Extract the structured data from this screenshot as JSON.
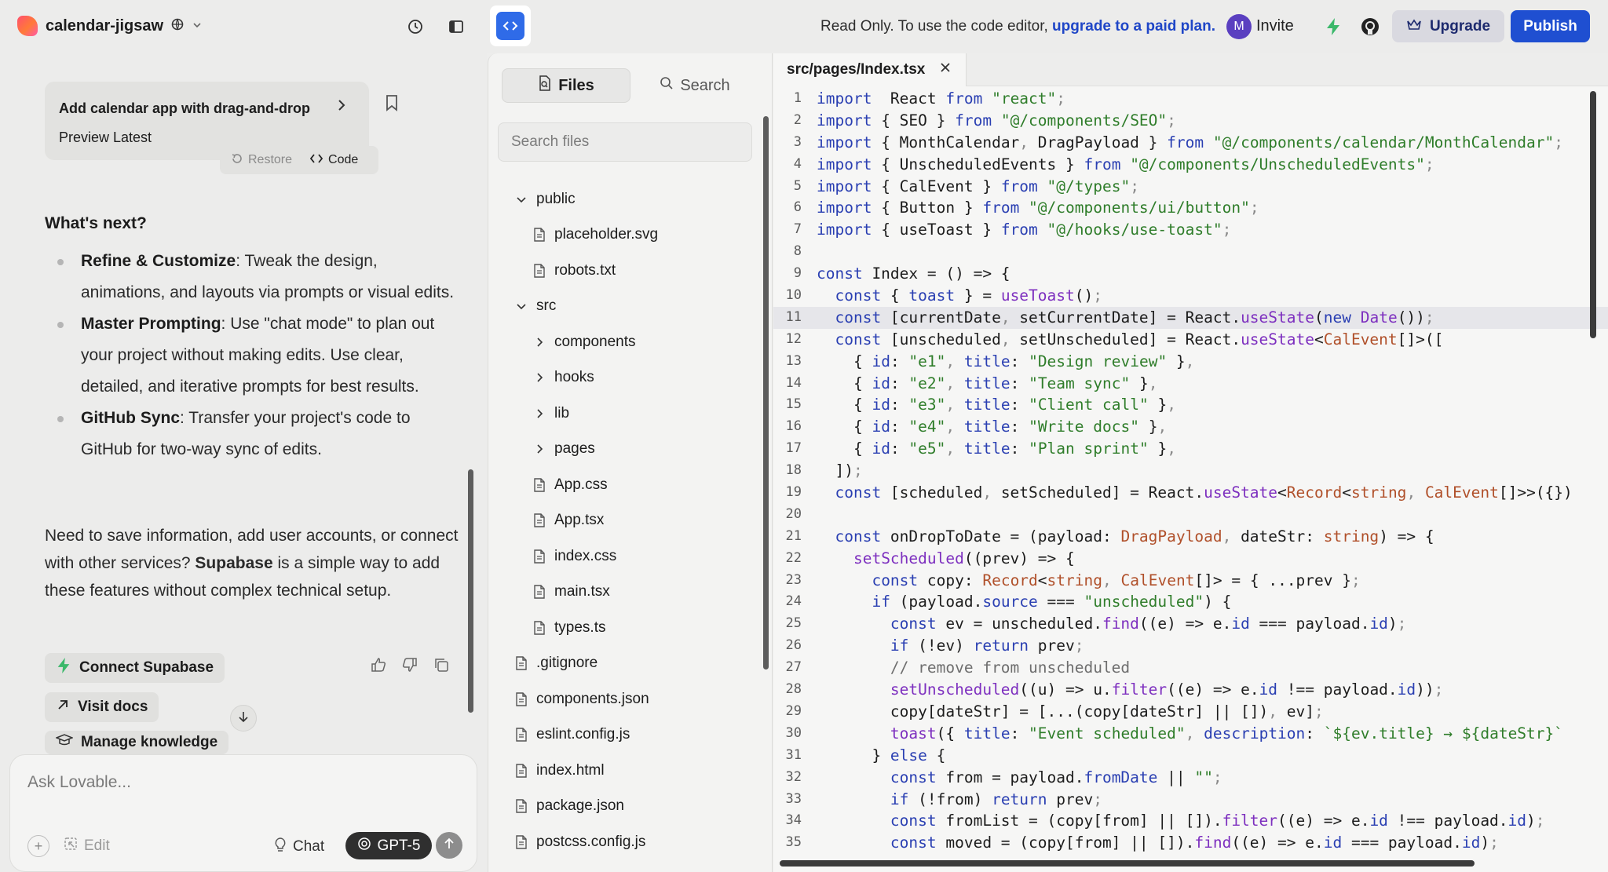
{
  "topbar": {
    "project_name": "calendar-jigsaw",
    "readonly_text": "Read Only. To use the code editor,",
    "upgrade_link": "upgrade to a paid plan.",
    "avatar_initial": "M",
    "invite_label": "Invite",
    "upgrade_label": "Upgrade",
    "publish_label": "Publish",
    "accent_color": "#2f6be8"
  },
  "chat": {
    "message_title": "Add calendar app with drag-and-drop",
    "message_sub": "Preview Latest",
    "restore_label": "Restore",
    "code_label": "Code",
    "whats_next": "What's next?",
    "bullets": [
      {
        "bold": "Refine & Customize",
        "text": ": Tweak the design, animations, and layouts via prompts or visual edits."
      },
      {
        "bold": "Master Prompting",
        "text": ": Use \"chat mode\" to plan out your project without making edits. Use clear, detailed, and iterative prompts for best results."
      },
      {
        "bold": "GitHub Sync",
        "text": ": Transfer your project's code to GitHub for two-way sync of edits."
      }
    ],
    "supabase_pre": "Need to save information, add user accounts, or connect with other services? ",
    "supabase_bold": "Supabase",
    "supabase_post": " is a simple way to add these features without complex technical setup.",
    "connect_supabase": "Connect Supabase",
    "visit_docs": "Visit docs",
    "manage_knowledge": "Manage knowledge",
    "composer_placeholder": "Ask Lovable...",
    "edit_label": "Edit",
    "chat_label": "Chat",
    "model_label": "GPT-5"
  },
  "explorer": {
    "files_tab": "Files",
    "search_tab": "Search",
    "search_placeholder": "Search files",
    "items": [
      {
        "name": "public",
        "type": "folder-open",
        "indent": 0
      },
      {
        "name": "placeholder.svg",
        "type": "file",
        "indent": 1
      },
      {
        "name": "robots.txt",
        "type": "file",
        "indent": 1
      },
      {
        "name": "src",
        "type": "folder-open",
        "indent": 0
      },
      {
        "name": "components",
        "type": "folder-closed",
        "indent": 1
      },
      {
        "name": "hooks",
        "type": "folder-closed",
        "indent": 1
      },
      {
        "name": "lib",
        "type": "folder-closed",
        "indent": 1
      },
      {
        "name": "pages",
        "type": "folder-closed",
        "indent": 1
      },
      {
        "name": "App.css",
        "type": "file",
        "indent": 1
      },
      {
        "name": "App.tsx",
        "type": "file",
        "indent": 1
      },
      {
        "name": "index.css",
        "type": "file",
        "indent": 1
      },
      {
        "name": "main.tsx",
        "type": "file",
        "indent": 1
      },
      {
        "name": "types.ts",
        "type": "file",
        "indent": 1
      },
      {
        "name": ".gitignore",
        "type": "file",
        "indent": 0
      },
      {
        "name": "components.json",
        "type": "file",
        "indent": 0
      },
      {
        "name": "eslint.config.js",
        "type": "file",
        "indent": 0
      },
      {
        "name": "index.html",
        "type": "file",
        "indent": 0
      },
      {
        "name": "package.json",
        "type": "file",
        "indent": 0
      },
      {
        "name": "postcss.config.js",
        "type": "file",
        "indent": 0
      }
    ]
  },
  "editor": {
    "tab_label": "src/pages/Index.tsx",
    "current_line": 11,
    "lines": [
      [
        [
          "k",
          "import"
        ],
        [
          "",
          "  React "
        ],
        [
          "k",
          "from"
        ],
        [
          "s",
          " \"react\""
        ],
        [
          "p",
          ";"
        ]
      ],
      [
        [
          "k",
          "import"
        ],
        [
          "",
          " { SEO } "
        ],
        [
          "k",
          "from"
        ],
        [
          "s",
          " \"@/components/SEO\""
        ],
        [
          "p",
          ";"
        ]
      ],
      [
        [
          "k",
          "import"
        ],
        [
          "",
          " { MonthCalendar"
        ],
        [
          "p",
          ","
        ],
        [
          "",
          " DragPayload } "
        ],
        [
          "k",
          "from"
        ],
        [
          "s",
          " \"@/components/calendar/MonthCalendar\""
        ],
        [
          "p",
          ";"
        ]
      ],
      [
        [
          "k",
          "import"
        ],
        [
          "",
          " { UnscheduledEvents } "
        ],
        [
          "k",
          "from"
        ],
        [
          "s",
          " \"@/components/UnscheduledEvents\""
        ],
        [
          "p",
          ";"
        ]
      ],
      [
        [
          "k",
          "import"
        ],
        [
          "",
          " { CalEvent } "
        ],
        [
          "k",
          "from"
        ],
        [
          "s",
          " \"@/types\""
        ],
        [
          "p",
          ";"
        ]
      ],
      [
        [
          "k",
          "import"
        ],
        [
          "",
          " { Button } "
        ],
        [
          "k",
          "from"
        ],
        [
          "s",
          " \"@/components/ui/button\""
        ],
        [
          "p",
          ";"
        ]
      ],
      [
        [
          "k",
          "import"
        ],
        [
          "",
          " { useToast } "
        ],
        [
          "k",
          "from"
        ],
        [
          "s",
          " \"@/hooks/use-toast\""
        ],
        [
          "p",
          ";"
        ]
      ],
      [],
      [
        [
          "k",
          "const"
        ],
        [
          "",
          " Index = () => {"
        ]
      ],
      [
        [
          "",
          "  "
        ],
        [
          "k",
          "const"
        ],
        [
          "",
          " { "
        ],
        [
          "k",
          "toast"
        ],
        [
          "",
          " } = "
        ],
        [
          "f",
          "useToast"
        ],
        [
          "",
          "()"
        ],
        [
          "p",
          ";"
        ]
      ],
      [
        [
          "",
          "  "
        ],
        [
          "k",
          "const"
        ],
        [
          "",
          " [currentDate"
        ],
        [
          "p",
          ","
        ],
        [
          "",
          " setCurrentDate] = React."
        ],
        [
          "f",
          "useState"
        ],
        [
          "",
          "("
        ],
        [
          "k",
          "new"
        ],
        [
          "",
          " "
        ],
        [
          "f",
          "Date"
        ],
        [
          "",
          "())"
        ],
        [
          "p",
          ";"
        ]
      ],
      [
        [
          "",
          "  "
        ],
        [
          "k",
          "const"
        ],
        [
          "",
          " [unscheduled"
        ],
        [
          "p",
          ","
        ],
        [
          "",
          " setUnscheduled] = React."
        ],
        [
          "f",
          "useState"
        ],
        [
          "",
          "<"
        ],
        [
          "t",
          "CalEvent"
        ],
        [
          "",
          "[]>(["
        ]
      ],
      [
        [
          "",
          "    { "
        ],
        [
          "k",
          "id"
        ],
        [
          "",
          ": "
        ],
        [
          "s",
          "\"e1\""
        ],
        [
          "p",
          ","
        ],
        [
          "",
          " "
        ],
        [
          "k",
          "title"
        ],
        [
          "",
          ": "
        ],
        [
          "s",
          "\"Design review\""
        ],
        [
          "",
          " }"
        ],
        [
          "p",
          ","
        ]
      ],
      [
        [
          "",
          "    { "
        ],
        [
          "k",
          "id"
        ],
        [
          "",
          ": "
        ],
        [
          "s",
          "\"e2\""
        ],
        [
          "p",
          ","
        ],
        [
          "",
          " "
        ],
        [
          "k",
          "title"
        ],
        [
          "",
          ": "
        ],
        [
          "s",
          "\"Team sync\""
        ],
        [
          "",
          " }"
        ],
        [
          "p",
          ","
        ]
      ],
      [
        [
          "",
          "    { "
        ],
        [
          "k",
          "id"
        ],
        [
          "",
          ": "
        ],
        [
          "s",
          "\"e3\""
        ],
        [
          "p",
          ","
        ],
        [
          "",
          " "
        ],
        [
          "k",
          "title"
        ],
        [
          "",
          ": "
        ],
        [
          "s",
          "\"Client call\""
        ],
        [
          "",
          " }"
        ],
        [
          "p",
          ","
        ]
      ],
      [
        [
          "",
          "    { "
        ],
        [
          "k",
          "id"
        ],
        [
          "",
          ": "
        ],
        [
          "s",
          "\"e4\""
        ],
        [
          "p",
          ","
        ],
        [
          "",
          " "
        ],
        [
          "k",
          "title"
        ],
        [
          "",
          ": "
        ],
        [
          "s",
          "\"Write docs\""
        ],
        [
          "",
          " }"
        ],
        [
          "p",
          ","
        ]
      ],
      [
        [
          "",
          "    { "
        ],
        [
          "k",
          "id"
        ],
        [
          "",
          ": "
        ],
        [
          "s",
          "\"e5\""
        ],
        [
          "p",
          ","
        ],
        [
          "",
          " "
        ],
        [
          "k",
          "title"
        ],
        [
          "",
          ": "
        ],
        [
          "s",
          "\"Plan sprint\""
        ],
        [
          "",
          " }"
        ],
        [
          "p",
          ","
        ]
      ],
      [
        [
          "",
          "  ])"
        ],
        [
          "p",
          ";"
        ]
      ],
      [
        [
          "",
          "  "
        ],
        [
          "k",
          "const"
        ],
        [
          "",
          " [scheduled"
        ],
        [
          "p",
          ","
        ],
        [
          "",
          " setScheduled] = React."
        ],
        [
          "f",
          "useState"
        ],
        [
          "",
          "<"
        ],
        [
          "t",
          "Record"
        ],
        [
          "",
          "<"
        ],
        [
          "t",
          "string"
        ],
        [
          "p",
          ","
        ],
        [
          "",
          " "
        ],
        [
          "t",
          "CalEvent"
        ],
        [
          "",
          "[]>>({})"
        ]
      ],
      [],
      [
        [
          "",
          "  "
        ],
        [
          "k",
          "const"
        ],
        [
          "",
          " onDropToDate = (payload: "
        ],
        [
          "t",
          "DragPayload"
        ],
        [
          "p",
          ","
        ],
        [
          "",
          " dateStr: "
        ],
        [
          "t",
          "string"
        ],
        [
          "",
          ") => {"
        ]
      ],
      [
        [
          "",
          "    "
        ],
        [
          "f",
          "setScheduled"
        ],
        [
          "",
          "((prev) => {"
        ]
      ],
      [
        [
          "",
          "      "
        ],
        [
          "k",
          "const"
        ],
        [
          "",
          " copy: "
        ],
        [
          "t",
          "Record"
        ],
        [
          "",
          "<"
        ],
        [
          "t",
          "string"
        ],
        [
          "p",
          ","
        ],
        [
          "",
          " "
        ],
        [
          "t",
          "CalEvent"
        ],
        [
          "",
          "[]> = { ...prev }"
        ],
        [
          "p",
          ";"
        ]
      ],
      [
        [
          "",
          "      "
        ],
        [
          "k",
          "if"
        ],
        [
          "",
          " (payload."
        ],
        [
          "k",
          "source"
        ],
        [
          "",
          " === "
        ],
        [
          "s",
          "\"unscheduled\""
        ],
        [
          "",
          ") {"
        ]
      ],
      [
        [
          "",
          "        "
        ],
        [
          "k",
          "const"
        ],
        [
          "",
          " ev = unscheduled."
        ],
        [
          "f",
          "find"
        ],
        [
          "",
          "((e) => e."
        ],
        [
          "k",
          "id"
        ],
        [
          "",
          " === payload."
        ],
        [
          "k",
          "id"
        ],
        [
          "",
          ")"
        ],
        [
          "p",
          ";"
        ]
      ],
      [
        [
          "",
          "        "
        ],
        [
          "k",
          "if"
        ],
        [
          "",
          " (!ev) "
        ],
        [
          "k",
          "return"
        ],
        [
          "",
          " prev"
        ],
        [
          "p",
          ";"
        ]
      ],
      [
        [
          "",
          "        "
        ],
        [
          "c",
          "// remove from unscheduled"
        ]
      ],
      [
        [
          "",
          "        "
        ],
        [
          "f",
          "setUnscheduled"
        ],
        [
          "",
          "((u) => u."
        ],
        [
          "f",
          "filter"
        ],
        [
          "",
          "((e) => e."
        ],
        [
          "k",
          "id"
        ],
        [
          "",
          " !== payload."
        ],
        [
          "k",
          "id"
        ],
        [
          "",
          "))"
        ],
        [
          "p",
          ";"
        ]
      ],
      [
        [
          "",
          "        copy[dateStr] = [...(copy[dateStr] || [])"
        ],
        [
          "p",
          ","
        ],
        [
          "",
          " ev]"
        ],
        [
          "p",
          ";"
        ]
      ],
      [
        [
          "",
          "        "
        ],
        [
          "f",
          "toast"
        ],
        [
          "",
          "({ "
        ],
        [
          "k",
          "title"
        ],
        [
          "",
          ": "
        ],
        [
          "s",
          "\"Event scheduled\""
        ],
        [
          "p",
          ","
        ],
        [
          "",
          " "
        ],
        [
          "k",
          "description"
        ],
        [
          "",
          ": "
        ],
        [
          "s",
          "`${ev.title} → ${dateStr}`"
        ]
      ],
      [
        [
          "",
          "      } "
        ],
        [
          "k",
          "else"
        ],
        [
          "",
          " {"
        ]
      ],
      [
        [
          "",
          "        "
        ],
        [
          "k",
          "const"
        ],
        [
          "",
          " from = payload."
        ],
        [
          "k",
          "fromDate"
        ],
        [
          "",
          " || "
        ],
        [
          "s",
          "\"\""
        ],
        [
          "p",
          ";"
        ]
      ],
      [
        [
          "",
          "        "
        ],
        [
          "k",
          "if"
        ],
        [
          "",
          " (!from) "
        ],
        [
          "k",
          "return"
        ],
        [
          "",
          " prev"
        ],
        [
          "p",
          ";"
        ]
      ],
      [
        [
          "",
          "        "
        ],
        [
          "k",
          "const"
        ],
        [
          "",
          " fromList = (copy[from] || [])."
        ],
        [
          "f",
          "filter"
        ],
        [
          "",
          "((e) => e."
        ],
        [
          "k",
          "id"
        ],
        [
          "",
          " !== payload."
        ],
        [
          "k",
          "id"
        ],
        [
          "",
          ")"
        ],
        [
          "p",
          ";"
        ]
      ],
      [
        [
          "",
          "        "
        ],
        [
          "k",
          "const"
        ],
        [
          "",
          " moved = (copy[from] || [])."
        ],
        [
          "f",
          "find"
        ],
        [
          "",
          "((e) => e."
        ],
        [
          "k",
          "id"
        ],
        [
          "",
          " === payload."
        ],
        [
          "k",
          "id"
        ],
        [
          "",
          ")"
        ],
        [
          "p",
          ";"
        ]
      ]
    ]
  }
}
